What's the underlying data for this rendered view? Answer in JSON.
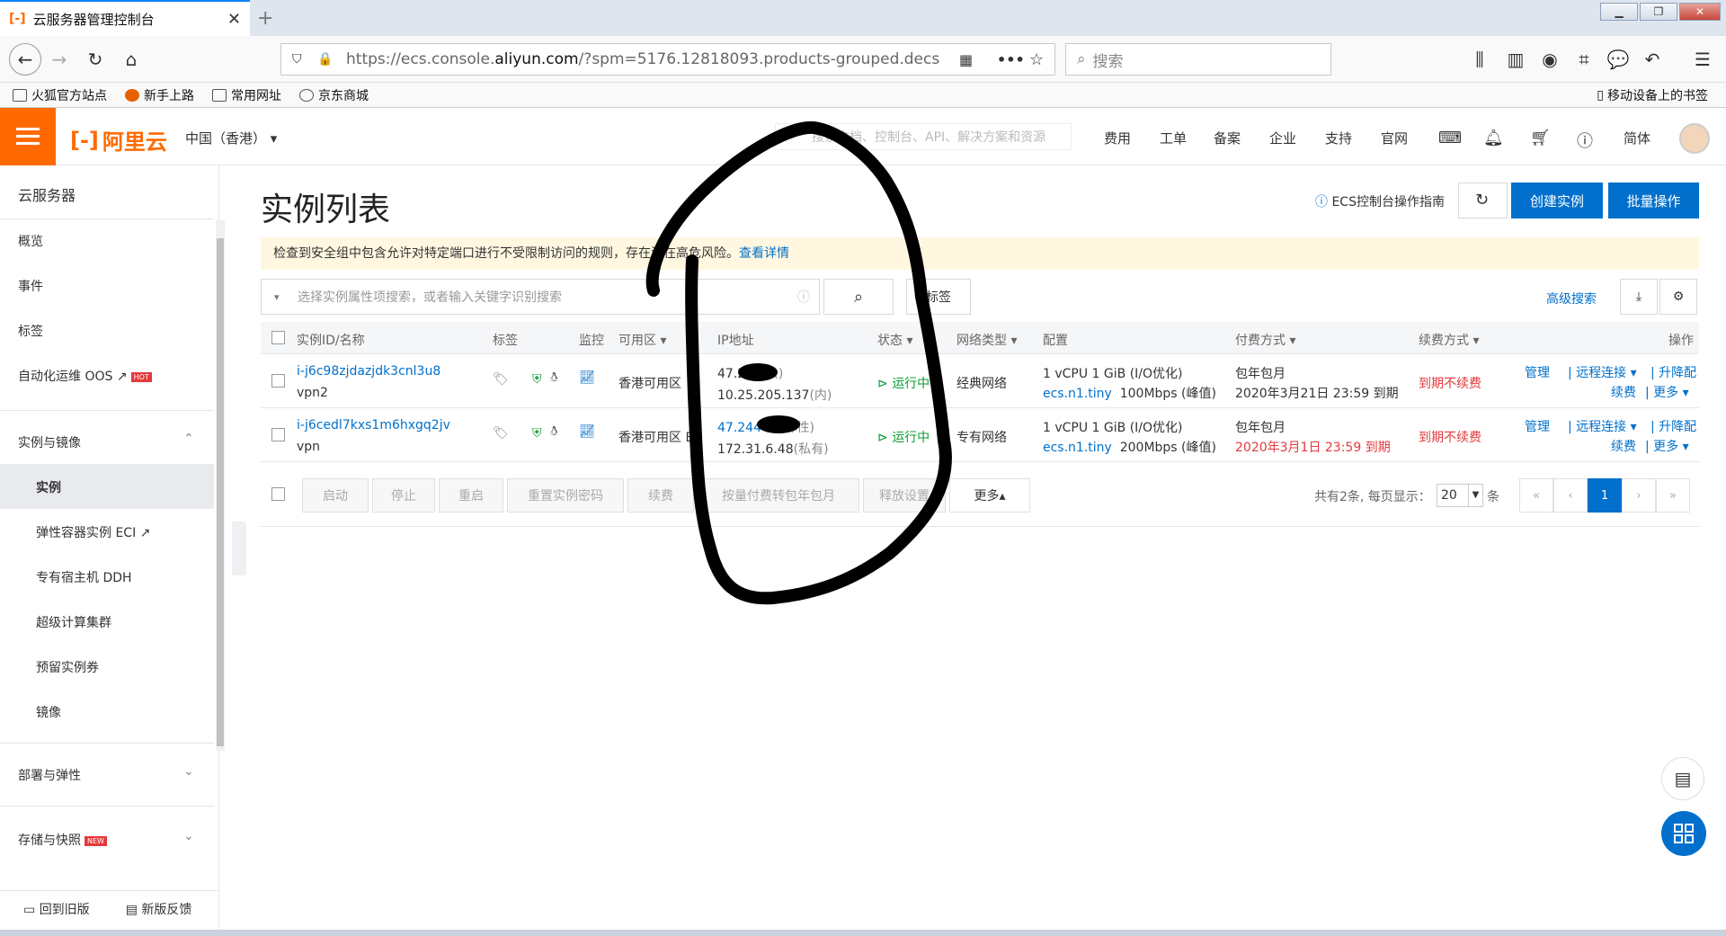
{
  "browser": {
    "tab_title": "云服务器管理控制台",
    "url_pre": "https://ecs.console.",
    "url_host": "aliyun.com",
    "url_post": "/?spm=5176.12818093.products-grouped.decs",
    "search_placeholder": "搜索",
    "bookmarks": [
      "火狐官方站点",
      "新手上路",
      "常用网址",
      "京东商城"
    ],
    "mobile_bookmarks": "移动设备上的书签"
  },
  "top": {
    "logo": "阿里云",
    "region": "中国（香港）",
    "search_placeholder": "搜索文档、控制台、API、解决方案和资源",
    "nav": [
      "费用",
      "工单",
      "备案",
      "企业",
      "支持",
      "官网",
      "简体"
    ]
  },
  "sidebar": {
    "title": "云服务器",
    "items": [
      "概览",
      "事件",
      "标签",
      "自动化运维 OOS"
    ],
    "hot": "HOT",
    "group1": "实例与镜像",
    "sub": [
      "实例",
      "弹性容器实例 ECI",
      "专有宿主机 DDH",
      "超级计算集群",
      "预留实例券",
      "镜像"
    ],
    "group2": "部署与弹性",
    "group3": "存储与快照",
    "new": "NEW",
    "back_old": "回到旧版",
    "feedback": "新版反馈"
  },
  "page": {
    "title": "实例列表",
    "guide": "ECS控制台操作指南",
    "create": "创建实例",
    "batch": "批量操作",
    "warning": "检查到安全组中包含允许对特定端口进行不受限制访问的规则，存在潜在高危风险。",
    "warning_link": "查看详情",
    "filter_placeholder": "选择实例属性项搜索，或者输入关键字识别搜索",
    "tag_btn": "标签",
    "adv_search": "高级搜索"
  },
  "table": {
    "headers": [
      "实例ID/名称",
      "标签",
      "监控",
      "可用区",
      "IP地址",
      "状态",
      "网络类型",
      "配置",
      "付费方式",
      "续费方式",
      "操作"
    ],
    "rows": [
      {
        "id": "i-j6c98zjdazjdk3cnl3u8",
        "name": "vpn2",
        "zone": "香港可用区",
        "ip1": "47.2   9",
        "ip1_tag": "(公)",
        "ip2": "10.25.205.137",
        "ip2_tag": "(内)",
        "status": "运行中",
        "net": "经典网络",
        "cfg1": "1 vCPU 1 GiB (I/O优化)",
        "cfg2a": "ecs.n1.tiny",
        "cfg2b": "100Mbps (峰值)",
        "pay": "包年包月",
        "expire": "2020年3月21日 23:59  到期",
        "expire_red": false,
        "renew": "到期不续费"
      },
      {
        "id": "i-j6cedl7kxs1m6hxgq2jv",
        "name": "vpn",
        "zone": "香港可用区 E",
        "ip1": "47.244    1",
        "ip1_tag": "(弹性)",
        "ip2": "172.31.6.48",
        "ip2_tag": "(私有)",
        "status": "运行中",
        "net": "专有网络",
        "cfg1": "1 vCPU 1 GiB (I/O优化)",
        "cfg2a": "ecs.n1.tiny",
        "cfg2b": "200Mbps (峰值)",
        "pay": "包年包月",
        "expire": "2020年3月1日 23:59  到期",
        "expire_red": true,
        "renew": "到期不续费"
      }
    ],
    "ops": {
      "manage": "管理",
      "remote": "远程连接",
      "upgrade": "升降配",
      "renew": "续费",
      "more": "更多"
    }
  },
  "footer": {
    "buttons": [
      "启动",
      "停止",
      "重启",
      "重置实例密码",
      "续费",
      "按量付费转包年包月",
      "释放设置",
      "更多▴"
    ],
    "page_info": "共有2条, 每页显示：",
    "page_size": "20",
    "page_unit": "条",
    "page": "1"
  },
  "colors": {
    "brand": "#ff6a00",
    "primary": "#0070cc",
    "warn_bg": "#fff7e0"
  }
}
